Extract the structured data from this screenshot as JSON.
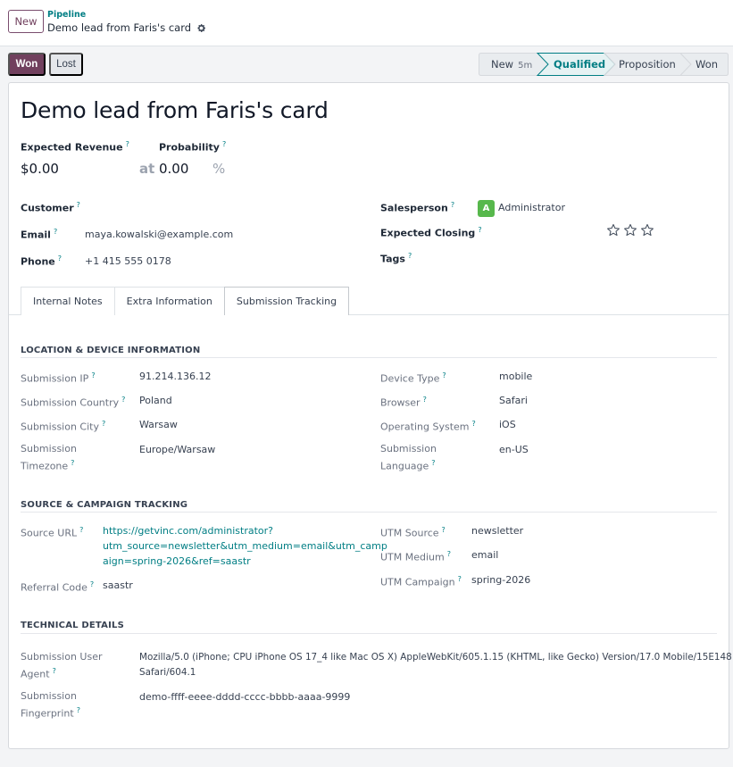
{
  "topbar": {
    "new_label": "New",
    "breadcrumb_parent": "Pipeline",
    "breadcrumb_current": "Demo lead from Faris's card"
  },
  "actions": {
    "won_label": "Won",
    "lost_label": "Lost"
  },
  "stages": [
    {
      "label": "New",
      "duration": "5m"
    },
    {
      "label": "Qualified",
      "duration": "",
      "active": true
    },
    {
      "label": "Proposition",
      "duration": ""
    },
    {
      "label": "Won",
      "duration": ""
    }
  ],
  "lead": {
    "title": "Demo lead from Faris's card",
    "expected_revenue_label": "Expected Revenue",
    "expected_revenue": "$0.00",
    "at_label": "at",
    "probability_label": "Probability",
    "probability": "0.00",
    "percent_sign": "%",
    "customer_label": "Customer",
    "customer": "",
    "email_label": "Email",
    "email": "maya.kowalski@example.com",
    "phone_label": "Phone",
    "phone": "+1 415 555 0178",
    "salesperson_label": "Salesperson",
    "salesperson_initial": "A",
    "salesperson": "Administrator",
    "expected_closing_label": "Expected Closing",
    "tags_label": "Tags",
    "priority_stars": 0,
    "help_mark": "?"
  },
  "tabs": [
    "Internal Notes",
    "Extra Information",
    "Submission Tracking"
  ],
  "active_tab": "Submission Tracking",
  "tracking": {
    "location_heading": "LOCATION & DEVICE INFORMATION",
    "submission_ip_label": "Submission IP",
    "submission_ip": "91.214.136.12",
    "submission_country_label": "Submission Country",
    "submission_country": "Poland",
    "submission_city_label": "Submission City",
    "submission_city": "Warsaw",
    "submission_timezone_label_1": "Submission",
    "submission_timezone_label_2": "Timezone",
    "submission_timezone": "Europe/Warsaw",
    "device_type_label": "Device Type",
    "device_type": "mobile",
    "browser_label": "Browser",
    "browser": "Safari",
    "os_label": "Operating System",
    "os": "iOS",
    "language_label_1": "Submission",
    "language_label_2": "Language",
    "language": "en-US",
    "source_heading": "SOURCE & CAMPAIGN TRACKING",
    "source_url_label": "Source URL",
    "source_url_1": "https://getvinc.com/administrator?",
    "source_url_2": "utm_source=newsletter&utm_medium=email&utm_camp",
    "source_url_3": "aign=spring-2026&ref=saastr",
    "referral_code_label": "Referral Code",
    "referral_code": "saastr",
    "utm_source_label": "UTM Source",
    "utm_source": "newsletter",
    "utm_medium_label": "UTM Medium",
    "utm_medium": "email",
    "utm_campaign_label": "UTM Campaign",
    "utm_campaign": "spring-2026",
    "technical_heading": "TECHNICAL DETAILS",
    "user_agent_label_1": "Submission User",
    "user_agent_label_2": "Agent",
    "user_agent_1": "Mozilla/5.0 (iPhone; CPU iPhone OS 17_4 like Mac OS X) AppleWebKit/605.1.15 (KHTML, like Gecko) Version/17.0 Mobile/15E148",
    "user_agent_2": "Safari/604.1",
    "fingerprint_label_1": "Submission",
    "fingerprint_label_2": "Fingerprint",
    "fingerprint": "demo-ffff-eeee-dddd-cccc-bbbb-aaaa-9999"
  },
  "colors": {
    "brand": "#71405e",
    "accent": "#017e84",
    "avatar": "#57b84c"
  },
  "icons": [
    "gear-icon",
    "star-icon"
  ]
}
